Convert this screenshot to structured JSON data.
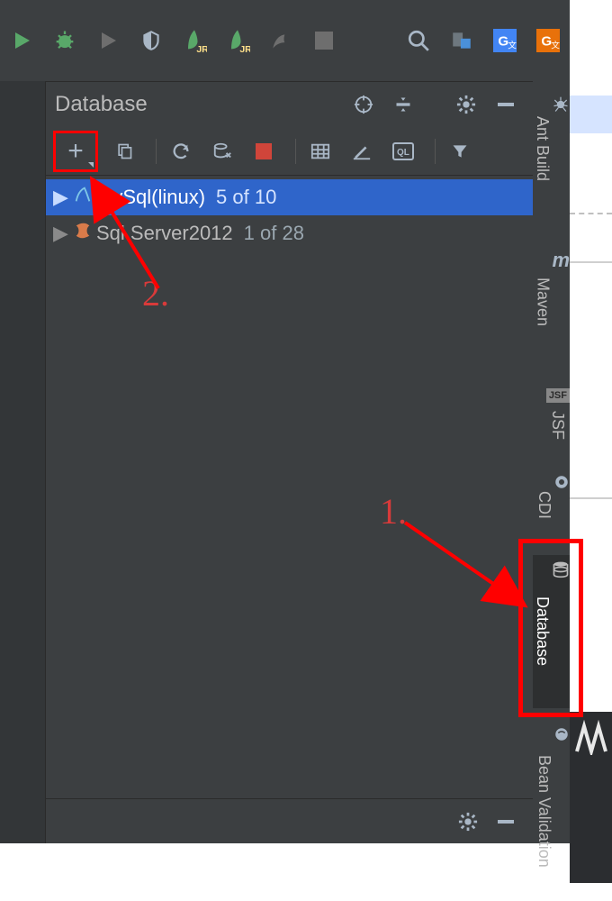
{
  "topToolbar": {
    "runLabel": "Run",
    "debugLabel": "Debug"
  },
  "panel": {
    "title": "Database",
    "footer": {}
  },
  "tree": {
    "items": [
      {
        "label": "MySql(linux)",
        "count": "5 of 10",
        "selected": true,
        "iconColor": "#4aa3df"
      },
      {
        "label": "Sql Server2012",
        "count": "1 of 28",
        "selected": false,
        "iconColor": "#d0453a"
      }
    ]
  },
  "sidebar": {
    "ant": "Ant Build",
    "maven": "Maven",
    "mavenLogo": "m",
    "jsf": "JSF",
    "jsfBadge": "JSF",
    "cdi": "CDI",
    "db": "Database",
    "bean": "Bean Validation"
  },
  "annotations": {
    "num1": "1.",
    "num2": "2."
  }
}
